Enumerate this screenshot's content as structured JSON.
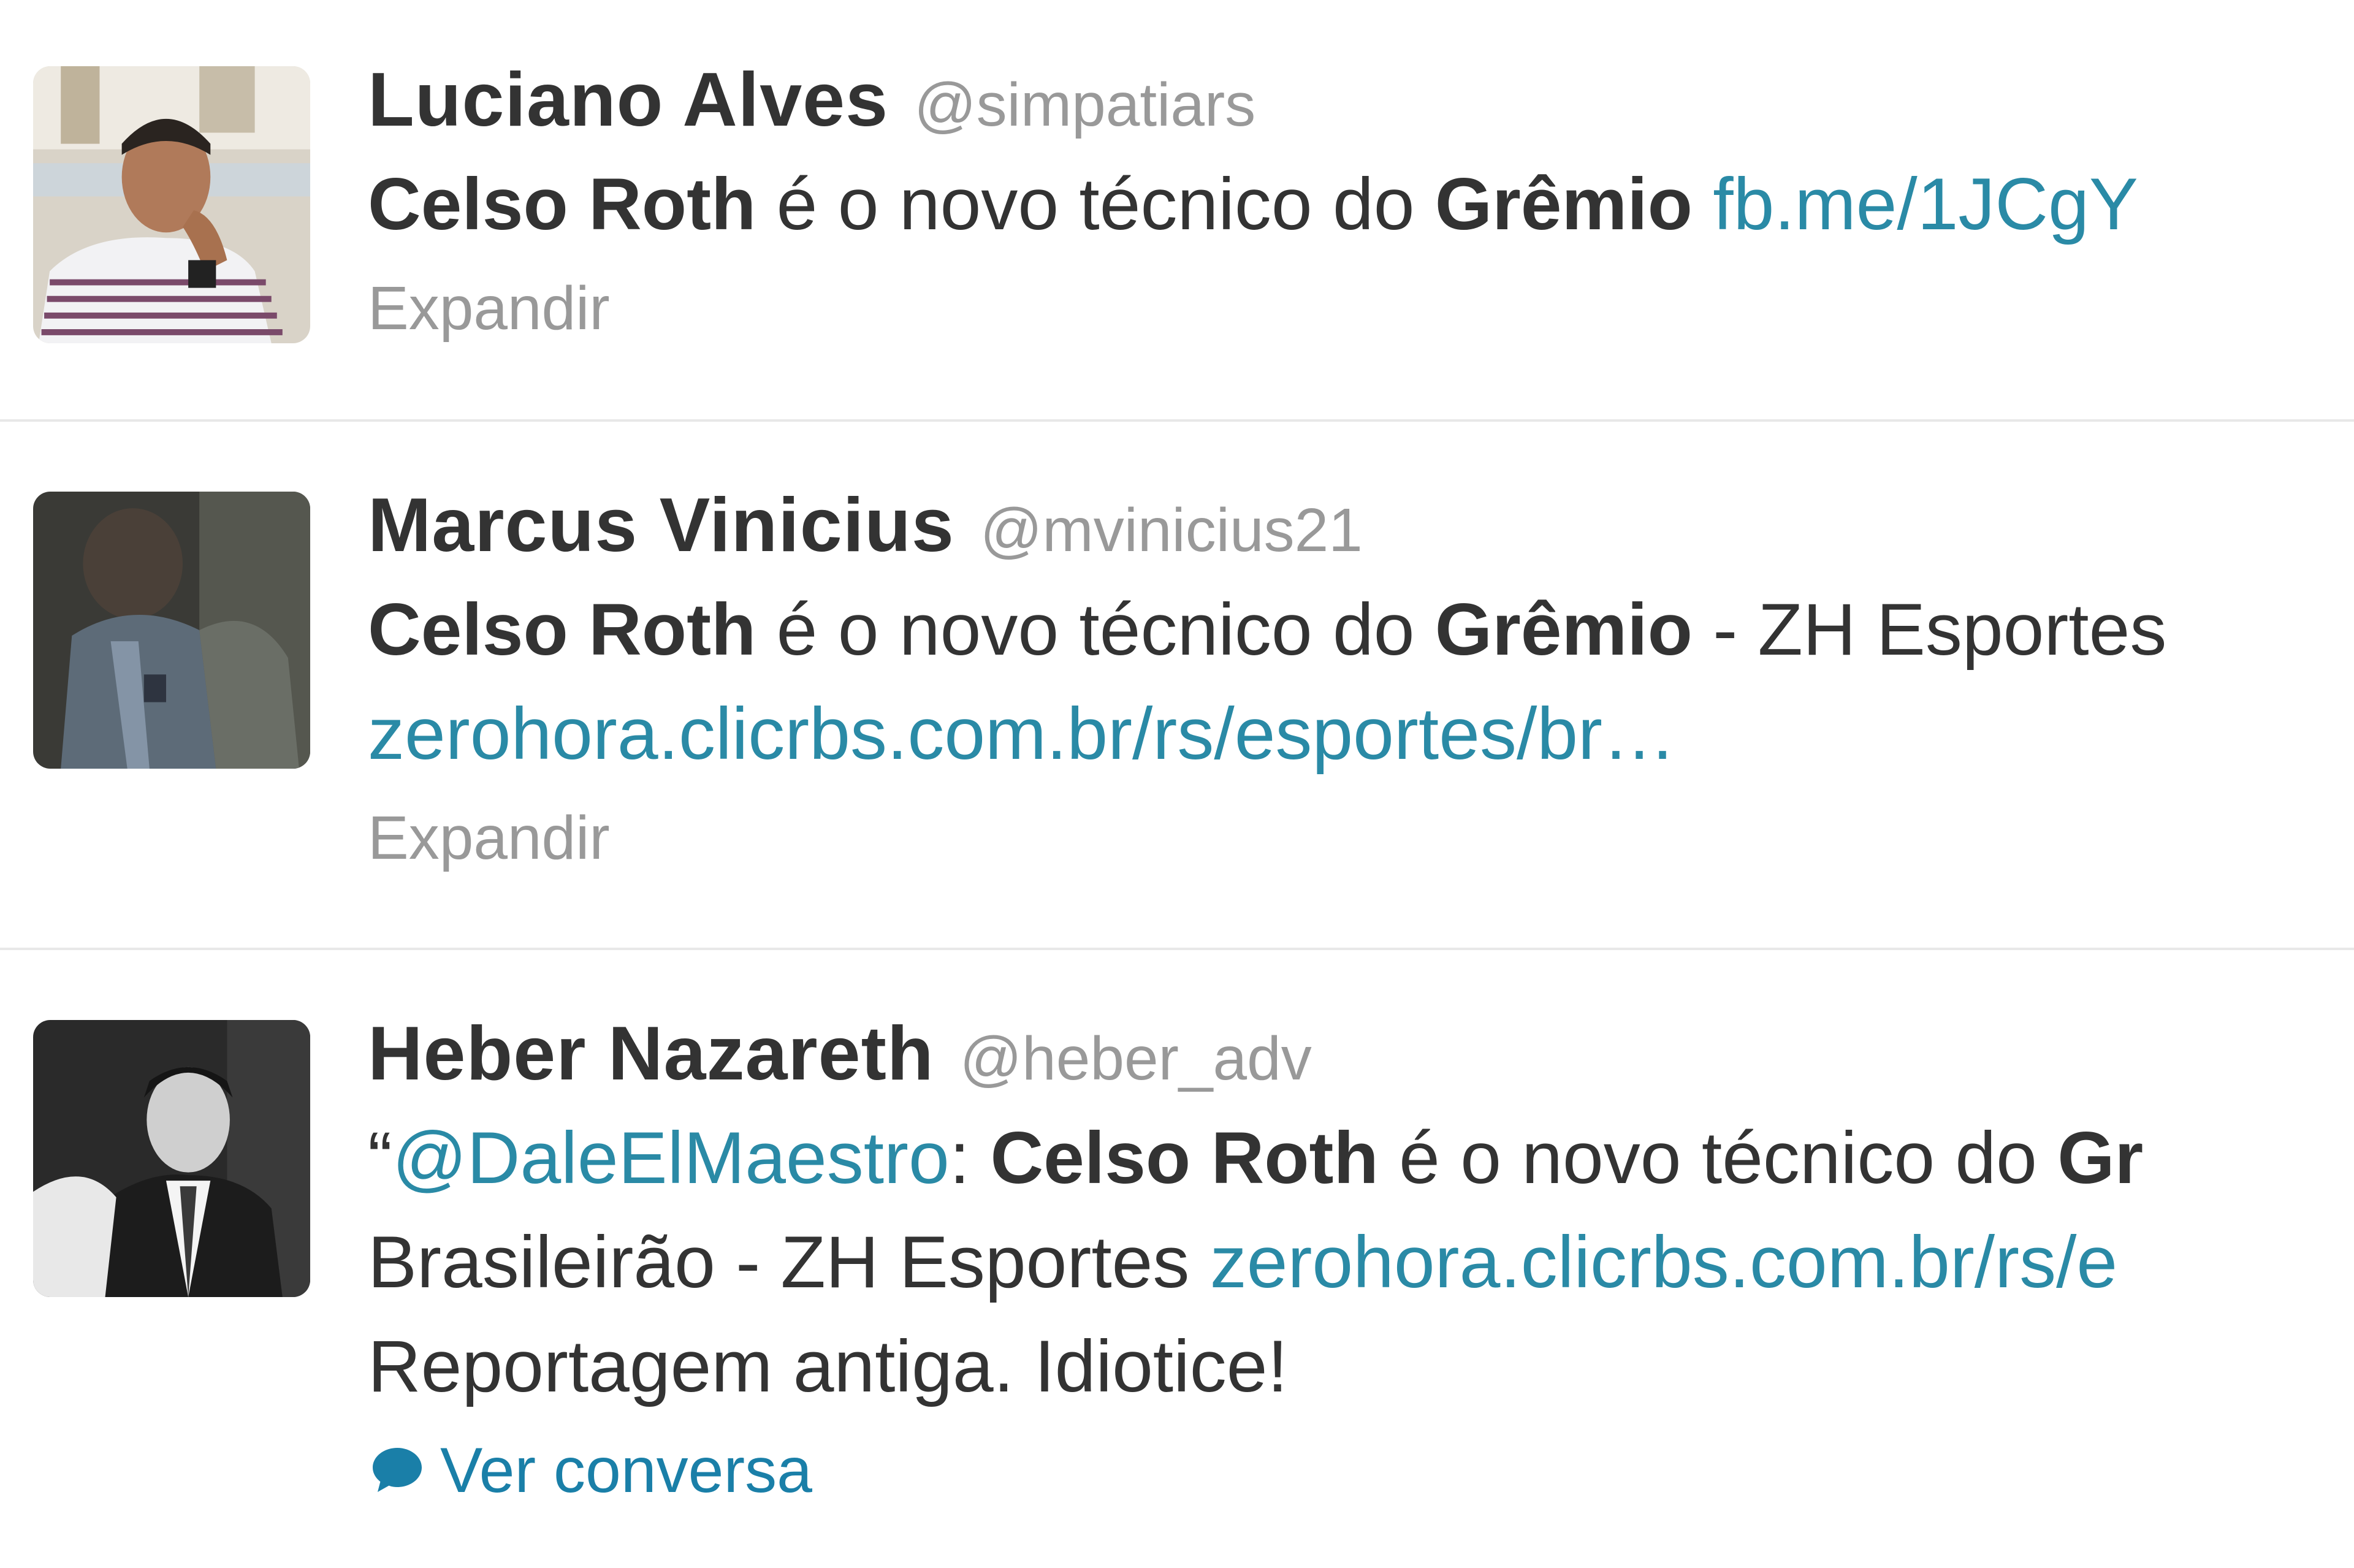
{
  "tweets": [
    {
      "fullname": "Luciano Alves",
      "screen_name": "@simpatiars",
      "lines": [
        [
          {
            "text": "Celso Roth",
            "style": "b"
          },
          {
            "text": " é o novo técnico do ",
            "style": ""
          },
          {
            "text": "Grêmio",
            "style": "b"
          },
          {
            "text": " ",
            "style": ""
          },
          {
            "text": "fb.me/1JCgY",
            "style": "link"
          }
        ]
      ],
      "action": "Expandir"
    },
    {
      "fullname": "Marcus Vinicius",
      "screen_name": "@mvinicius21",
      "lines": [
        [
          {
            "text": "Celso Roth",
            "style": "b"
          },
          {
            "text": " é o novo técnico do ",
            "style": ""
          },
          {
            "text": "Grêmio",
            "style": "b"
          },
          {
            "text": " - ZH Esportes",
            "style": ""
          }
        ],
        [
          {
            "text": "zerohora.clicrbs.com.br/rs/esportes/br…",
            "style": "link"
          }
        ]
      ],
      "action": "Expandir"
    },
    {
      "fullname": "Heber Nazareth",
      "screen_name": "@heber_adv",
      "lines": [
        [
          {
            "text": "“",
            "style": ""
          },
          {
            "text": "@DaleElMaestro",
            "style": "link"
          },
          {
            "text": ": ",
            "style": ""
          },
          {
            "text": "Celso Roth",
            "style": "b"
          },
          {
            "text": " é o novo técnico do ",
            "style": ""
          },
          {
            "text": "Gr",
            "style": "b"
          }
        ],
        [
          {
            "text": "Brasileirão - ZH Esportes ",
            "style": ""
          },
          {
            "text": "zerohora.clicrbs.com.br/rs/e",
            "style": "link"
          }
        ],
        [
          {
            "text": "Reportagem antiga. Idiotice!",
            "style": ""
          }
        ]
      ],
      "action": "Ver conversa"
    }
  ],
  "colors": {
    "name": "#333333",
    "muted": "#999999",
    "link": "#2a8aa6",
    "divider": "#e8e8e8"
  },
  "icons": {
    "conversation": "speech-bubble-icon"
  }
}
